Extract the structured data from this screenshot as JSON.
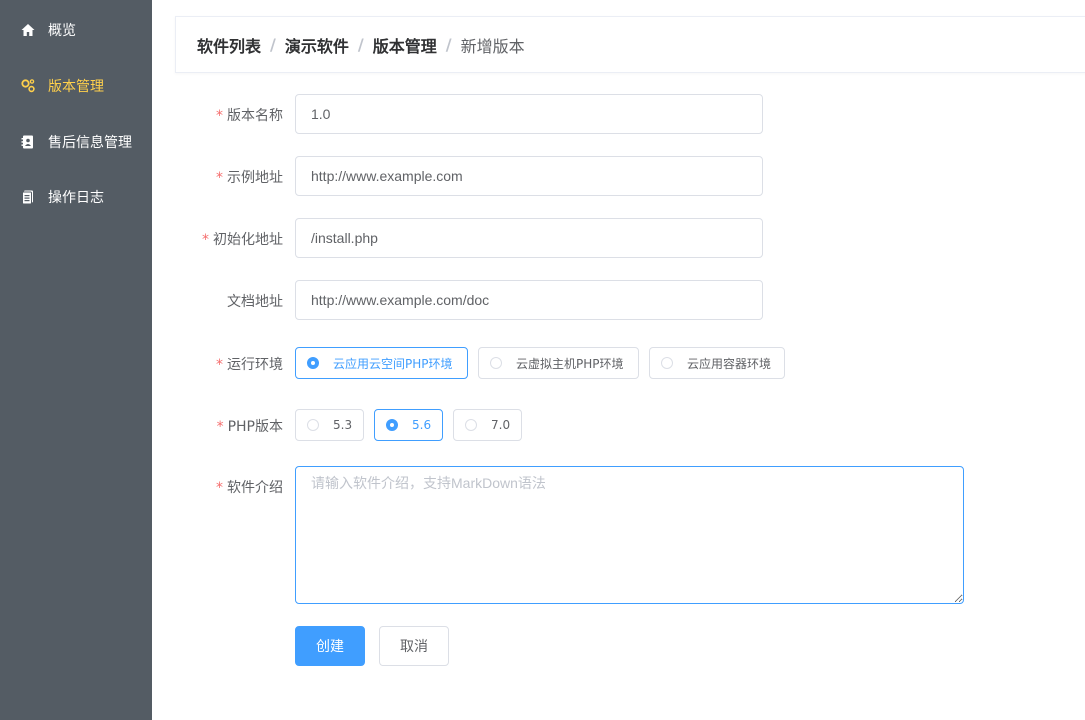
{
  "sidebar": {
    "items": [
      {
        "label": "概览",
        "icon": "home-icon",
        "active": false
      },
      {
        "label": "版本管理",
        "icon": "cogs-icon",
        "active": true
      },
      {
        "label": "售后信息管理",
        "icon": "contacts-icon",
        "active": false
      },
      {
        "label": "操作日志",
        "icon": "document-icon",
        "active": false
      }
    ],
    "bg_color": "#545c64",
    "active_color": "#ffd04b"
  },
  "breadcrumb": {
    "items": [
      "软件列表",
      "演示软件",
      "版本管理",
      "新增版本"
    ],
    "separator": "/"
  },
  "form": {
    "version_name": {
      "label": "版本名称",
      "required": true,
      "value": "1.0"
    },
    "demo_url": {
      "label": "示例地址",
      "required": true,
      "value": "http://www.example.com"
    },
    "init_url": {
      "label": "初始化地址",
      "required": true,
      "value": "/install.php"
    },
    "doc_url": {
      "label": "文档地址",
      "required": false,
      "value": "http://www.example.com/doc"
    },
    "runtime": {
      "label": "运行环境",
      "required": true,
      "options": [
        "云应用云空间PHP环境",
        "云虚拟主机PHP环境",
        "云应用容器环境"
      ],
      "selected": "云应用云空间PHP环境"
    },
    "php_version": {
      "label": "PHP版本",
      "required": true,
      "options": [
        "5.3",
        "5.6",
        "7.0"
      ],
      "selected": "5.6"
    },
    "intro": {
      "label": "软件介绍",
      "required": true,
      "value": "",
      "placeholder": "请输入软件介绍，支持MarkDown语法"
    },
    "required_mark": "*"
  },
  "actions": {
    "create_label": "创建",
    "cancel_label": "取消"
  },
  "colors": {
    "primary": "#409eff",
    "required": "#f56c6c",
    "border": "#dcdfe6"
  }
}
